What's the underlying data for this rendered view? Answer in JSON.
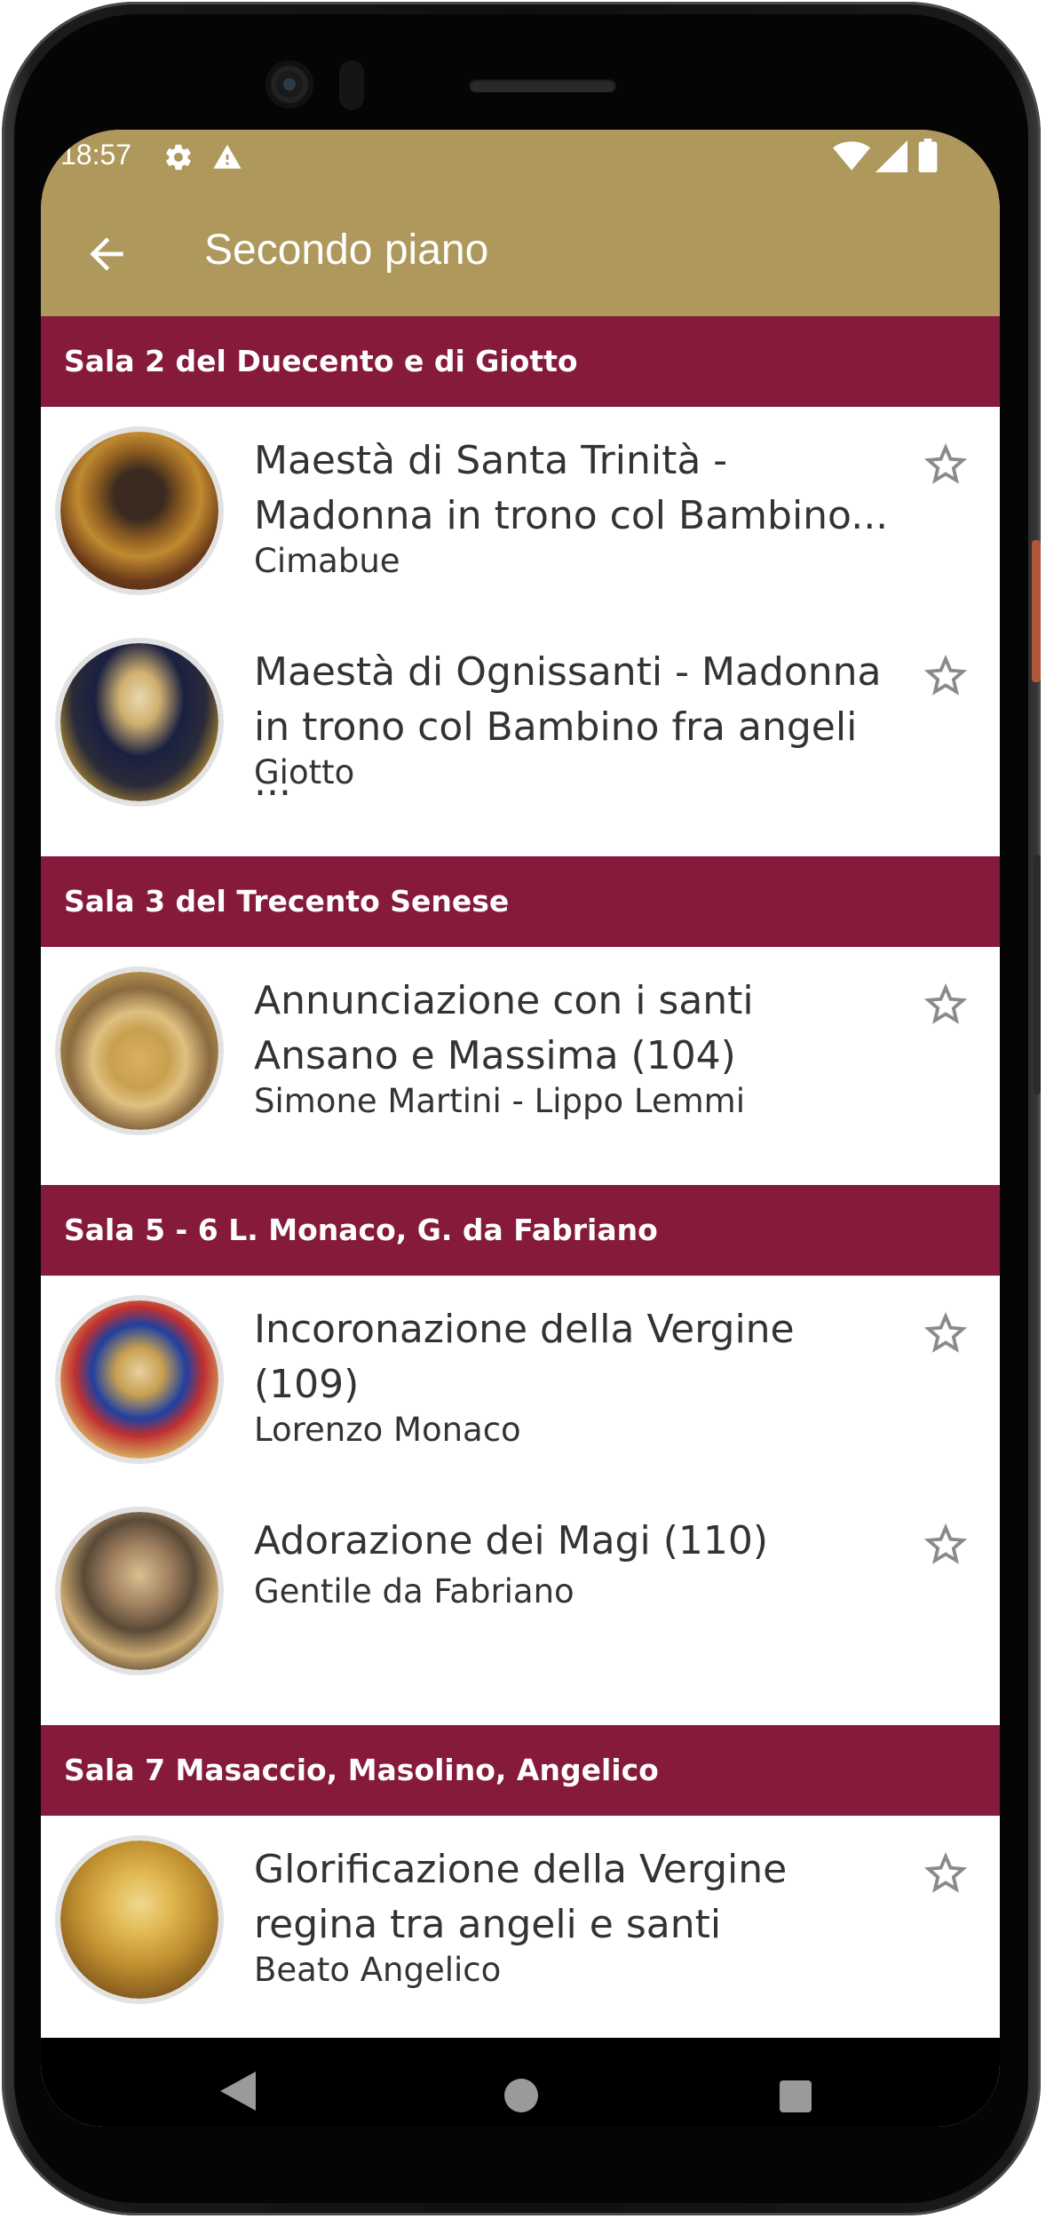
{
  "status_bar": {
    "time": "18:57",
    "icons": [
      "settings-icon",
      "warning-icon",
      "wifi-icon",
      "signal-icon",
      "battery-icon"
    ]
  },
  "toolbar": {
    "title": "Secondo piano",
    "back_icon": "arrow-back-icon",
    "background_color": "#ae985c"
  },
  "colors": {
    "section_header": "#851a3b",
    "text": "#333333",
    "star": "#8a8a8a"
  },
  "sections": [
    {
      "title": "Sala 2 del Duecento e di Giotto",
      "items": [
        {
          "title_line1": "Maestà di Santa Trinità -",
          "title_line2": "Madonna in trono col Bambino...",
          "author": "Cimabue",
          "favorite_icon": "star-outline-icon"
        },
        {
          "title_line1": "Maestà di Ognissanti - Madonna",
          "title_line2": "in trono col Bambino fra angeli ...",
          "author": "Giotto",
          "favorite_icon": "star-outline-icon"
        }
      ]
    },
    {
      "title": "Sala 3 del Trecento Senese",
      "items": [
        {
          "title_line1": "Annunciazione con i santi",
          "title_line2": "Ansano e Massima (104)",
          "author": "Simone Martini - Lippo Lemmi",
          "favorite_icon": "star-outline-icon"
        }
      ]
    },
    {
      "title": "Sala 5 - 6 L. Monaco, G. da Fabriano",
      "items": [
        {
          "title_line1": "Incoronazione della Vergine",
          "title_line2": "(109)",
          "author": "Lorenzo Monaco",
          "favorite_icon": "star-outline-icon"
        },
        {
          "title_line1": "Adorazione dei Magi (110)",
          "title_line2": "",
          "author": "Gentile da Fabriano",
          "favorite_icon": "star-outline-icon"
        }
      ]
    },
    {
      "title": "Sala 7 Masaccio, Masolino, Angelico",
      "items": [
        {
          "title_line1": "Glorificazione della Vergine",
          "title_line2": "regina tra angeli e santi",
          "author": "Beato Angelico",
          "favorite_icon": "star-outline-icon"
        }
      ]
    }
  ],
  "nav_bar": {
    "buttons": [
      "nav-back-icon",
      "nav-home-icon",
      "nav-recents-icon"
    ]
  }
}
